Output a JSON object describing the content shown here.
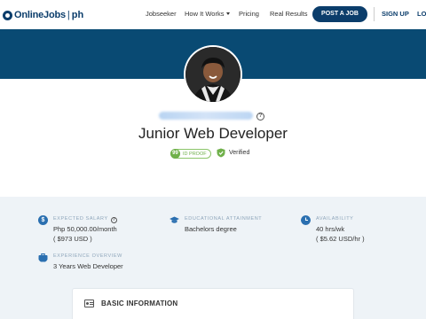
{
  "nav": {
    "logo_text": "OnlineJobs",
    "logo_separator": "|",
    "logo_suffix": "ph",
    "links": {
      "jobseeker": "Jobseeker",
      "how_it_works": "How It Works",
      "pricing": "Pricing",
      "real_results": "Real Results"
    },
    "post_job": "POST A JOB",
    "sign_up": "SIGN UP",
    "login": "LOGIN"
  },
  "profile": {
    "job_title": "Junior Web Developer",
    "id_proof_score": "99",
    "id_proof_label": "ID PROOF",
    "verified_label": "Verified",
    "help_glyph": "?"
  },
  "stats": {
    "salary": {
      "label": "EXPECTED SALARY",
      "value": "Php 50,000.00/month",
      "sub": "( $973 USD )",
      "icon": "dollar-icon"
    },
    "education": {
      "label": "EDUCATIONAL ATTAINMENT",
      "value": "Bachelors degree",
      "icon": "graduation-cap-icon"
    },
    "availability": {
      "label": "AVAILABILITY",
      "value": "40 hrs/wk",
      "sub": "( $5.62 USD/hr )",
      "icon": "clock-icon"
    },
    "experience": {
      "label": "EXPERIENCE OVERVIEW",
      "value": "3 Years Web Developer",
      "icon": "briefcase-icon"
    }
  },
  "basic_info": {
    "title": "BASIC INFORMATION",
    "icon": "id-card-icon"
  },
  "colors": {
    "brand": "#0b3d6b",
    "banner": "#094a73",
    "accent_icon": "#2a6fb0",
    "verified_green": "#6fb04a",
    "section_bg": "#eef3f7"
  }
}
